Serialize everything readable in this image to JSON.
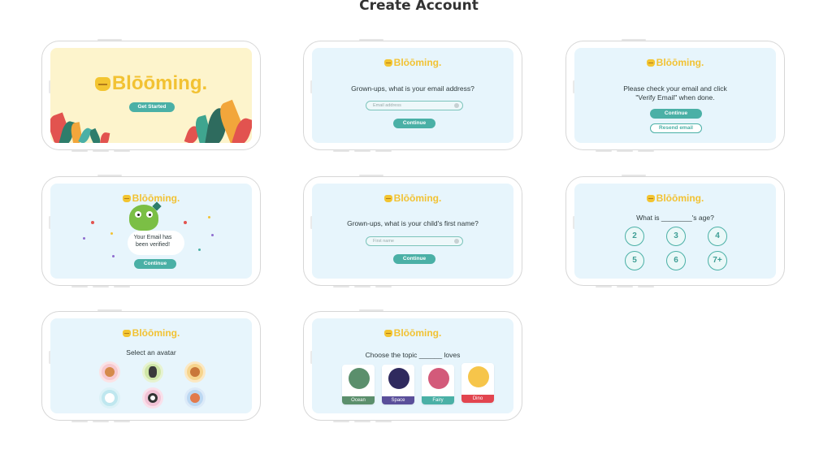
{
  "page": {
    "title": "Create Account"
  },
  "brand": {
    "name": "Blōōming.",
    "color": "#f2c233",
    "accent": "#4ab0a6"
  },
  "welcome": {
    "cta_label": "Get Started"
  },
  "email_step": {
    "prompt": "Grown-ups, what is your email address?",
    "placeholder": "Email address",
    "continue_label": "Continue"
  },
  "verify_step": {
    "prompt_line1": "Please check your email and click",
    "prompt_line2": "\"Verify Email\" when done.",
    "continue_label": "Continue",
    "resend_label": "Resend email"
  },
  "verified_step": {
    "message_line1": "Your Email has",
    "message_line2": "been verified!",
    "continue_label": "Continue"
  },
  "child_name_step": {
    "prompt": "Grown-ups, what is  your child's first name?",
    "placeholder": "First name",
    "continue_label": "Continue"
  },
  "age_step": {
    "prompt": "What is ________'s age?",
    "options": [
      "2",
      "3",
      "4",
      "5",
      "6",
      "7+"
    ]
  },
  "avatar_step": {
    "prompt": "Select an avatar",
    "avatars": [
      "bear-avatar",
      "zebra-avatar",
      "monkey-avatar",
      "bird-avatar",
      "panda-avatar",
      "penguin-avatar"
    ]
  },
  "topic_step": {
    "prompt": "Choose the topic ______ loves",
    "topics": [
      {
        "label": "Ocean",
        "color": "#5b8f6c"
      },
      {
        "label": "Space",
        "color": "#5a4f9a"
      },
      {
        "label": "Fairy",
        "color": "#4ab0a6"
      },
      {
        "label": "Dino",
        "color": "#e2454f"
      }
    ]
  }
}
